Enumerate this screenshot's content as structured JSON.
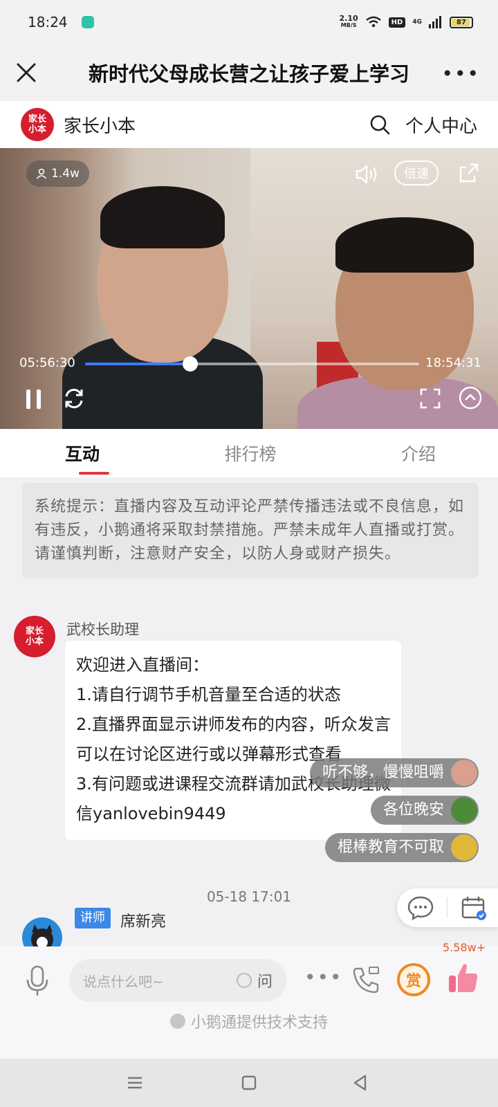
{
  "status": {
    "time": "18:24",
    "net_speed_value": "2.10",
    "net_speed_unit": "MB/S",
    "hd": "HD",
    "signal": "4G",
    "battery": "87"
  },
  "title_bar": {
    "title": "新时代父母成长营之让孩子爱上学习"
  },
  "shop": {
    "logo_line1": "家长",
    "logo_line2": "小本",
    "name": "家长小本",
    "personal_center": "个人中心"
  },
  "video": {
    "viewers": "1.4w",
    "speed_label": "倍速",
    "current_time": "05:56:30",
    "total_time": "18:54:31",
    "progress": 0.315
  },
  "tabs": [
    {
      "label": "互动",
      "active": true
    },
    {
      "label": "排行榜",
      "active": false
    },
    {
      "label": "介绍",
      "active": false
    }
  ],
  "chat": {
    "notice": "系统提示：直播内容及互动评论严禁传播违法或不良信息，如有违反，小鹅通将采取封禁措施。严禁未成年人直播或打赏。请谨慎判断，注意财产安全，以防人身或财产损失。",
    "message": {
      "sender": "武校长助理",
      "lines": [
        "欢迎进入直播间：",
        "1.请自行调节手机音量至合适的状态",
        "2.直播界面显示讲师发布的内容，听众发言可以在讨论区进行或以弹幕形式查看",
        "3.有问题或进课程交流群请加武校长助理微信yanlovebin9449"
      ]
    },
    "timestamp": "05-18 17:01",
    "lecturer_tag": "讲师",
    "lecturer_name": "席新亮",
    "danmaku": [
      {
        "text": "听不够，慢慢咀嚼",
        "avatar_color": "#d9a08f"
      },
      {
        "text": "各位晚安",
        "avatar_color": "#4f8a3c"
      },
      {
        "text": "棍棒教育不可取",
        "avatar_color": "#e0b838"
      }
    ]
  },
  "bottom": {
    "input_placeholder": "说点什么吧~",
    "ask_label": "问",
    "reward_label": "赏",
    "like_count": "5.58w+",
    "tech_support": "小鹅通提供技术支持"
  },
  "colors": {
    "accent_red": "#e2373f",
    "progress_blue": "#3d7bff",
    "lecturer_tag": "#3b88e8",
    "reward_orange": "#f08a22"
  }
}
